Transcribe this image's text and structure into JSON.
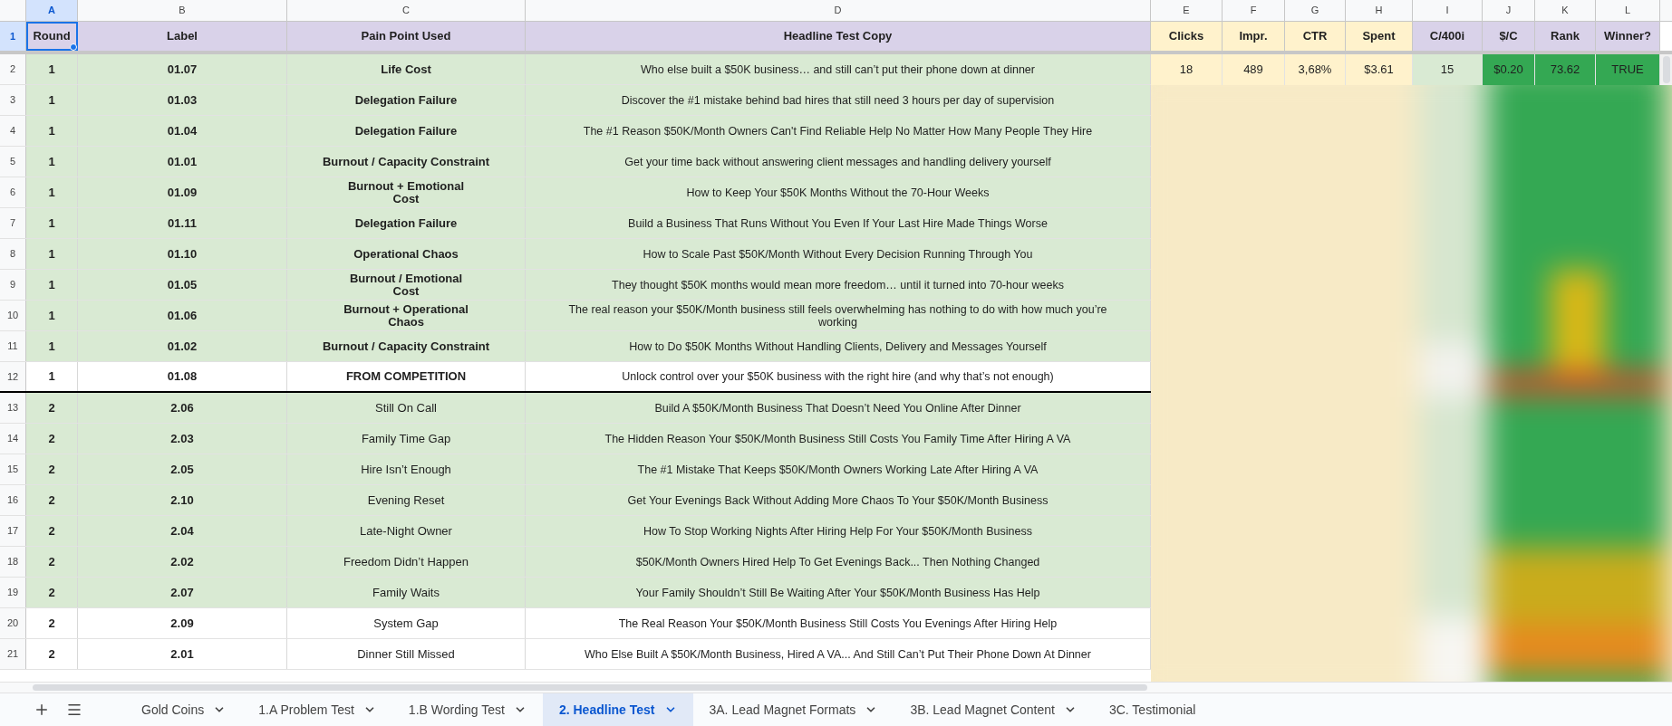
{
  "columns": [
    {
      "letter": "A",
      "selected": true
    },
    {
      "letter": "B",
      "selected": false
    },
    {
      "letter": "C",
      "selected": false
    },
    {
      "letter": "D",
      "selected": false
    },
    {
      "letter": "E",
      "selected": false
    },
    {
      "letter": "F",
      "selected": false
    },
    {
      "letter": "G",
      "selected": false
    },
    {
      "letter": "H",
      "selected": false
    },
    {
      "letter": "I",
      "selected": false
    },
    {
      "letter": "J",
      "selected": false
    },
    {
      "letter": "K",
      "selected": false
    },
    {
      "letter": "L",
      "selected": false
    }
  ],
  "header_row": {
    "number": "1",
    "selected": true,
    "cells": [
      {
        "text": "Round",
        "color": "#d9d2e9",
        "selected": true
      },
      {
        "text": "Label",
        "color": "#d9d2e9",
        "selected": false
      },
      {
        "text": "Pain Point Used",
        "color": "#d9d2e9",
        "selected": false
      },
      {
        "text": "Headline Test Copy",
        "color": "#d9d2e9",
        "selected": false
      },
      {
        "text": "Clicks",
        "color": "#fff2cc",
        "selected": false
      },
      {
        "text": "Impr.",
        "color": "#fff2cc",
        "selected": false
      },
      {
        "text": "CTR",
        "color": "#fff2cc",
        "selected": false
      },
      {
        "text": "Spent",
        "color": "#fff2cc",
        "selected": false
      },
      {
        "text": "C/400i",
        "color": "#d9d2e9",
        "selected": false
      },
      {
        "text": "$/C",
        "color": "#d9d2e9",
        "selected": false
      },
      {
        "text": "Rank",
        "color": "#d9d2e9",
        "selected": false
      },
      {
        "text": "Winner?",
        "color": "#d9d2e9",
        "selected": false
      }
    ]
  },
  "rows": [
    {
      "number": "2",
      "round": "1",
      "label": "01.07",
      "pain_point": "Life Cost",
      "pain_bold": true,
      "headline": "Who else built a $50K business… and still can’t put their phone down at dinner",
      "color": "#d9ead3",
      "thick_border": false
    },
    {
      "number": "3",
      "round": "1",
      "label": "01.03",
      "pain_point": "Delegation Failure",
      "pain_bold": true,
      "headline": "Discover the #1 mistake behind bad hires that still need 3 hours per day of supervision",
      "color": "#d9ead3",
      "thick_border": false
    },
    {
      "number": "4",
      "round": "1",
      "label": "01.04",
      "pain_point": "Delegation Failure",
      "pain_bold": true,
      "headline": "The #1 Reason $50K/Month Owners Can't Find Reliable Help No Matter How Many People They Hire",
      "color": "#d9ead3",
      "thick_border": false
    },
    {
      "number": "5",
      "round": "1",
      "label": "01.01",
      "pain_point": "Burnout / Capacity Constraint",
      "pain_bold": true,
      "headline": "Get your time back without answering client messages and handling delivery yourself",
      "color": "#d9ead3",
      "thick_border": false
    },
    {
      "number": "6",
      "round": "1",
      "label": "01.09",
      "pain_point": "Burnout + Emotional\nCost",
      "pain_bold": true,
      "headline": "How to Keep Your $50K Months Without the 70-Hour Weeks",
      "color": "#d9ead3",
      "thick_border": false
    },
    {
      "number": "7",
      "round": "1",
      "label": "01.11",
      "pain_point": "Delegation Failure",
      "pain_bold": true,
      "headline": "Build a Business That Runs Without You Even If Your Last Hire Made Things Worse",
      "color": "#d9ead3",
      "thick_border": false
    },
    {
      "number": "8",
      "round": "1",
      "label": "01.10",
      "pain_point": "Operational Chaos",
      "pain_bold": true,
      "headline": "How to Scale Past $50K/Month Without Every Decision Running Through You",
      "color": "#d9ead3",
      "thick_border": false
    },
    {
      "number": "9",
      "round": "1",
      "label": "01.05",
      "pain_point": "Burnout / Emotional\nCost",
      "pain_bold": true,
      "headline": "They thought $50K months would mean more freedom… until it turned into 70-hour weeks",
      "color": "#d9ead3",
      "thick_border": false
    },
    {
      "number": "10",
      "round": "1",
      "label": "01.06",
      "pain_point": "Burnout + Operational\nChaos",
      "pain_bold": true,
      "headline": "The real reason your $50K/Month business still feels overwhelming has nothing to do with how much you’re\nworking",
      "color": "#d9ead3",
      "thick_border": false
    },
    {
      "number": "11",
      "round": "1",
      "label": "01.02",
      "pain_point": "Burnout / Capacity Constraint",
      "pain_bold": true,
      "headline": "How to Do $50K Months Without Handling Clients, Delivery and Messages Yourself",
      "color": "#d9ead3",
      "thick_border": false
    },
    {
      "number": "12",
      "round": "1",
      "label": "01.08",
      "pain_point": "FROM COMPETITION",
      "pain_bold": true,
      "headline": "Unlock control over your $50K business with the right hire (and why that’s not enough)",
      "color": "#ffffff",
      "thick_border": true
    },
    {
      "number": "13",
      "round": "2",
      "label": "2.06",
      "pain_point": "Still On Call",
      "pain_bold": false,
      "headline": "Build A $50K/Month Business That Doesn’t Need You Online After Dinner",
      "color": "#d9ead3",
      "thick_border": false
    },
    {
      "number": "14",
      "round": "2",
      "label": "2.03",
      "pain_point": "Family Time Gap",
      "pain_bold": false,
      "headline": "The Hidden Reason Your $50K/Month Business Still Costs You Family Time After Hiring A VA",
      "color": "#d9ead3",
      "thick_border": false
    },
    {
      "number": "15",
      "round": "2",
      "label": "2.05",
      "pain_point": "Hire Isn’t Enough",
      "pain_bold": false,
      "headline": "The #1 Mistake That Keeps $50K/Month Owners Working Late After Hiring A VA",
      "color": "#d9ead3",
      "thick_border": false
    },
    {
      "number": "16",
      "round": "2",
      "label": "2.10",
      "pain_point": "Evening Reset",
      "pain_bold": false,
      "headline": "Get Your Evenings Back Without Adding More Chaos To Your $50K/Month Business",
      "color": "#d9ead3",
      "thick_border": false
    },
    {
      "number": "17",
      "round": "2",
      "label": "2.04",
      "pain_point": "Late-Night Owner",
      "pain_bold": false,
      "headline": "How To Stop Working Nights After Hiring Help For Your $50K/Month Business",
      "color": "#d9ead3",
      "thick_border": false
    },
    {
      "number": "18",
      "round": "2",
      "label": "2.02",
      "pain_point": "Freedom Didn’t Happen",
      "pain_bold": false,
      "headline": "$50K/Month Owners Hired Help To Get Evenings Back... Then Nothing Changed",
      "color": "#d9ead3",
      "thick_border": false
    },
    {
      "number": "19",
      "round": "2",
      "label": "2.07",
      "pain_point": "Family Waits",
      "pain_bold": false,
      "headline": "Your Family Shouldn’t Still Be Waiting After Your $50K/Month Business Has Help",
      "color": "#d9ead3",
      "thick_border": false
    },
    {
      "number": "20",
      "round": "2",
      "label": "2.09",
      "pain_point": "System Gap",
      "pain_bold": false,
      "headline": "The Real Reason Your $50K/Month Business Still Costs You Evenings After Hiring Help",
      "color": "#ffffff",
      "thick_border": false
    },
    {
      "number": "21",
      "round": "2",
      "label": "2.01",
      "pain_point": "Dinner Still Missed",
      "pain_bold": false,
      "headline": "Who Else Built A $50K/Month Business, Hired A VA... And Still Can’t Put Their Phone Down At Dinner",
      "color": "#ffffff",
      "thick_border": false
    }
  ],
  "first_row_metrics": [
    {
      "value": "18",
      "color": "#fff2cc"
    },
    {
      "value": "489",
      "color": "#fff2cc"
    },
    {
      "value": "3,68%",
      "color": "#fff2cc"
    },
    {
      "value": "$3.61",
      "color": "#fff2cc"
    },
    {
      "value": "15",
      "color": "#d9ead3"
    },
    {
      "value": "$0.20",
      "color": "#34a853"
    },
    {
      "value": "73.62",
      "color": "#34a853"
    },
    {
      "value": "TRUE",
      "color": "#34a853"
    }
  ],
  "sheet_tabs": [
    {
      "label": "Gold Coins",
      "selected": false
    },
    {
      "label": "1.A Problem Test",
      "selected": false
    },
    {
      "label": "1.B Wording Test",
      "selected": false
    },
    {
      "label": "2. Headline Test",
      "selected": true
    },
    {
      "label": "3A. Lead Magnet Formats",
      "selected": false
    },
    {
      "label": "3B. Lead Magnet Content",
      "selected": false
    },
    {
      "label": "3C. Testimonial",
      "selected": false
    }
  ]
}
